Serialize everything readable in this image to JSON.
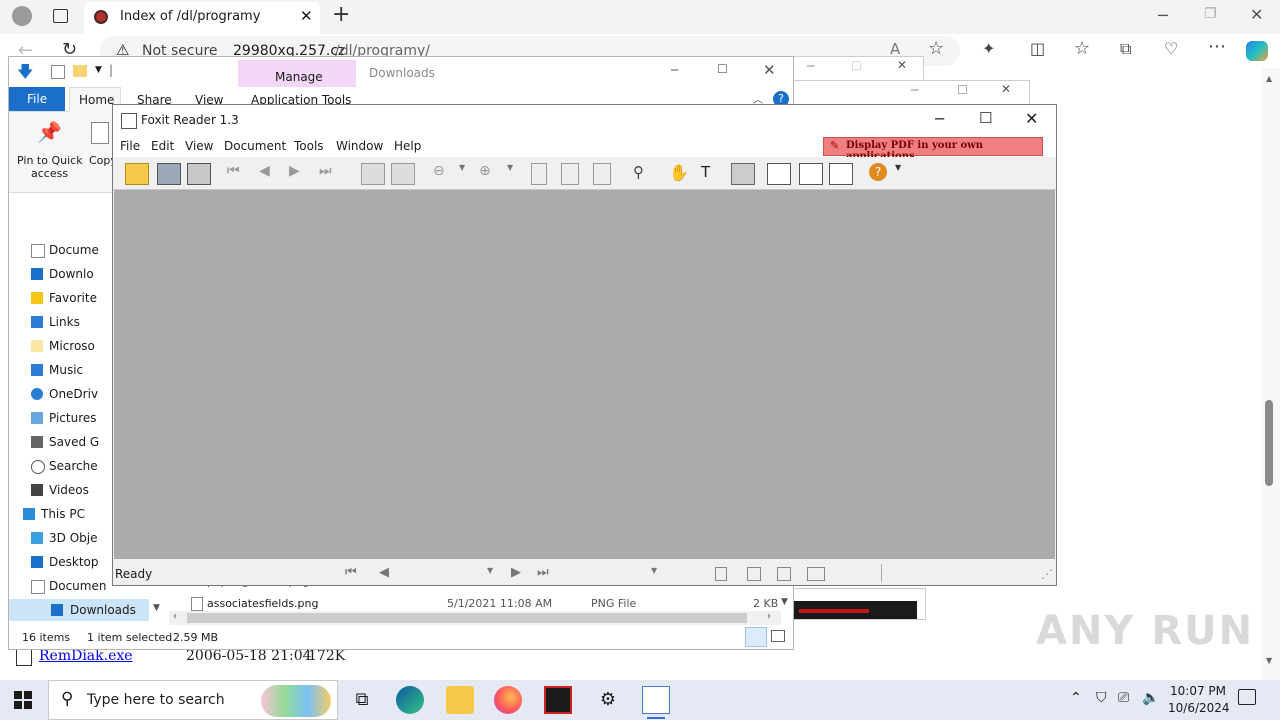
{
  "browser": {
    "tab_title": "Index of /dl/programy",
    "security_label": "Not secure",
    "url_host": "29980xq.257.cz",
    "url_path": "/dl/programy/",
    "listing": [
      {
        "name": "RemDiak.exe",
        "date": "2006-05-18 21:04",
        "size": "172K"
      }
    ]
  },
  "explorer": {
    "title": "Downloads",
    "context_tab_group": "Manage",
    "tabs": [
      "File",
      "Home",
      "Share",
      "View",
      "Application Tools"
    ],
    "ribbon": {
      "pin_label_1": "Pin to Quick",
      "pin_label_2": "access",
      "copy_label": "Copy"
    },
    "nav_items": [
      "Docume",
      "Downlo",
      "Favorite",
      "Links",
      "Microso",
      "Music",
      "OneDriv",
      "Pictures",
      "Saved G",
      "Searche",
      "Videos",
      "This PC",
      "3D Obje",
      "Desktop",
      "Documen",
      "Downloads"
    ],
    "file_row": {
      "partial_name": "paperlgrenera.png",
      "name": "associatesfields.png",
      "date": "5/1/2021 11:08 AM",
      "type": "PNG File",
      "size": "2 KB"
    },
    "status": {
      "items": "16 items",
      "selected": "1 item selected",
      "size": "2.59 MB"
    }
  },
  "foxit": {
    "title": "Foxit Reader 1.3",
    "menu": [
      "File",
      "Edit",
      "View",
      "Document",
      "Tools",
      "Window",
      "Help"
    ],
    "promo": "Display PDF in your own applications",
    "status": "Ready"
  },
  "taskbar": {
    "search_placeholder": "Type here to search",
    "time": "10:07 PM",
    "date": "10/6/2024"
  },
  "watermark": "ANY RUN",
  "colors": {
    "accent": "#0063b1",
    "manage_tab": "#f2d7f6",
    "promo_bg": "#f08080",
    "viewer_bg": "#aaaaaa"
  }
}
